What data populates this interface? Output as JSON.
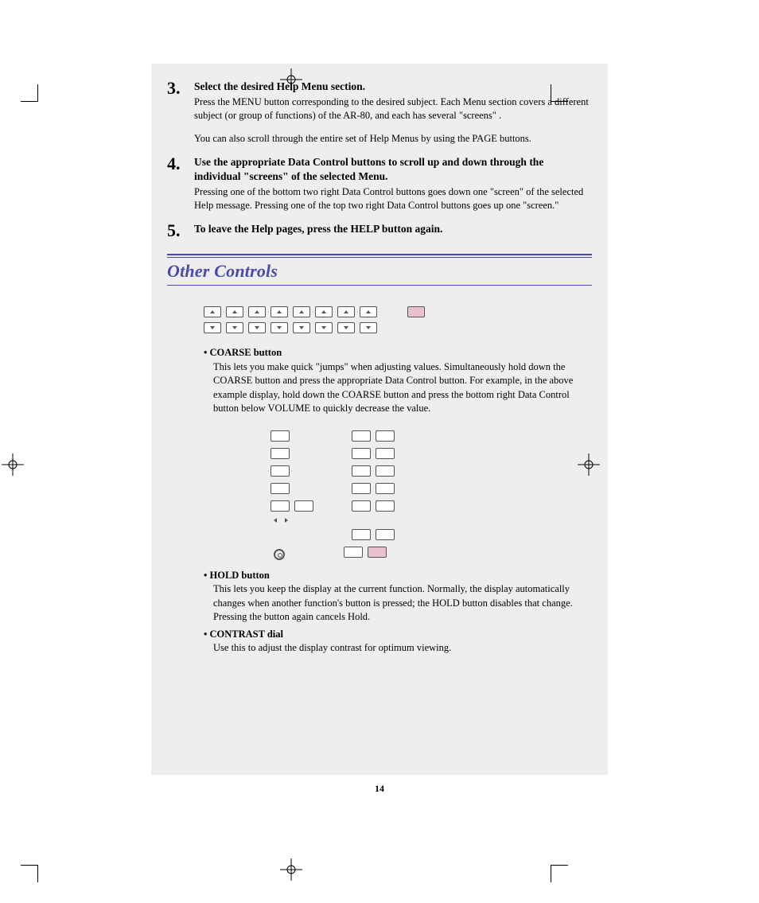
{
  "steps": [
    {
      "num": "3.",
      "title": "Select the desired Help Menu section.",
      "p1": "Press the MENU button corresponding to the desired subject.  Each Menu section covers a different subject (or group of functions) of the AR-80, and each has several \"screens\" .",
      "p2": "You can also scroll through the entire set of Help Menus by using the PAGE buttons."
    },
    {
      "num": "4.",
      "title": "Use the appropriate Data Control buttons to scroll up and down through the individual \"screens\" of the selected Menu.",
      "p1": "Pressing one of the bottom two right Data Control buttons goes down one \"screen\" of the selected Help message. Pressing one of the top two right Data Control buttons goes up one \"screen.\""
    },
    {
      "num": "5.",
      "title": "To leave the Help pages, press the HELP button again."
    }
  ],
  "section_title": "Other Controls",
  "bullet_coarse": {
    "label": "• COARSE button",
    "text": "This lets you make quick \"jumps\" when adjusting values.  Simultaneously hold down the COARSE button and press the appropriate Data Control button.  For example, in the above example display, hold down the COARSE button and press the bottom right Data Control button below VOLUME to quickly decrease the value."
  },
  "bullet_hold": {
    "label": "• HOLD button",
    "text": "This lets you keep the display at the current function.  Normally, the display automatically changes when another function's button is pressed; the HOLD button disables that change.  Pressing the button again cancels Hold."
  },
  "bullet_contrast": {
    "label": "• CONTRAST dial",
    "text": "Use this to adjust the display contrast for optimum viewing."
  },
  "page_number": "14"
}
